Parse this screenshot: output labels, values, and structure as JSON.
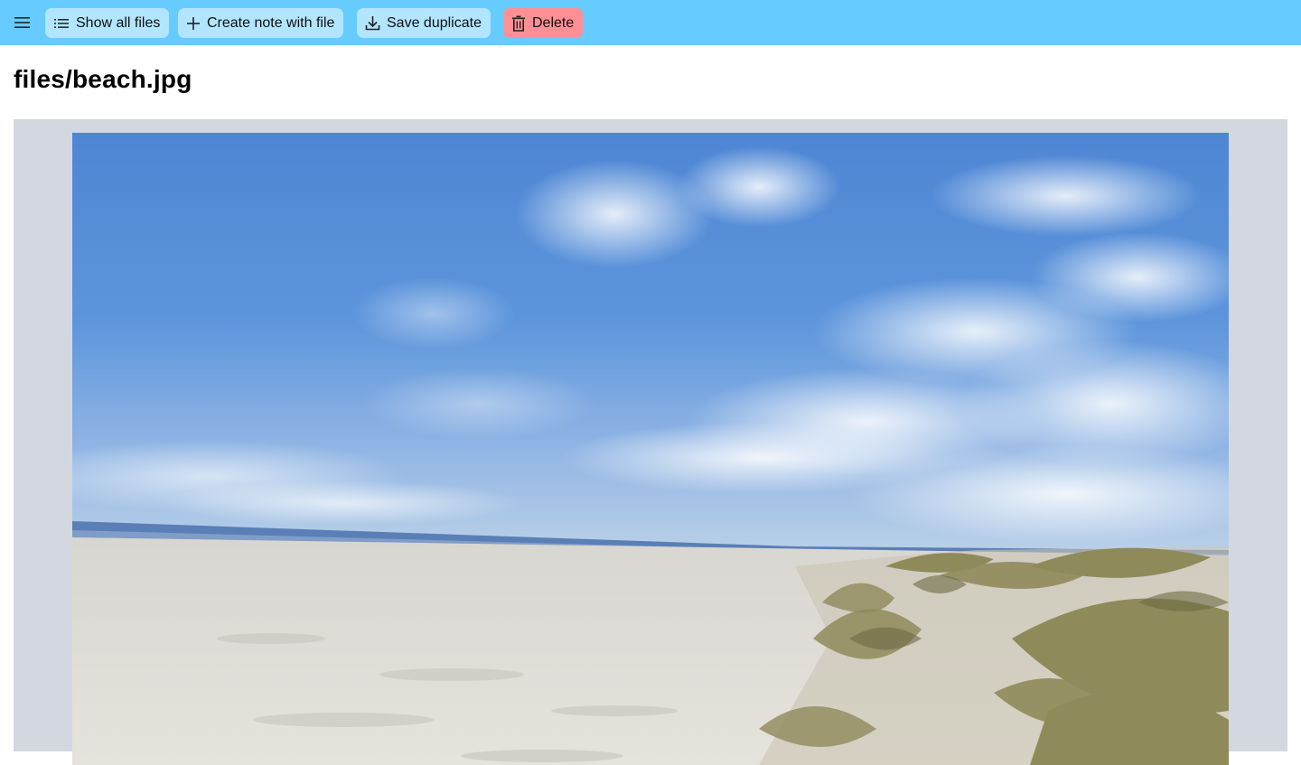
{
  "toolbar": {
    "menu_icon": "hamburger-menu-icon",
    "show_all_files_label": "Show all files",
    "create_note_label": "Create note with file",
    "save_duplicate_label": "Save duplicate",
    "delete_label": "Delete",
    "colors": {
      "bar": "#66ccff",
      "button": "#b2e5ff",
      "delete_button": "#ff8f94"
    }
  },
  "page": {
    "title": "files/beach.jpg"
  },
  "preview": {
    "content": "beach-photo",
    "frame_color": "#d3d7df"
  }
}
